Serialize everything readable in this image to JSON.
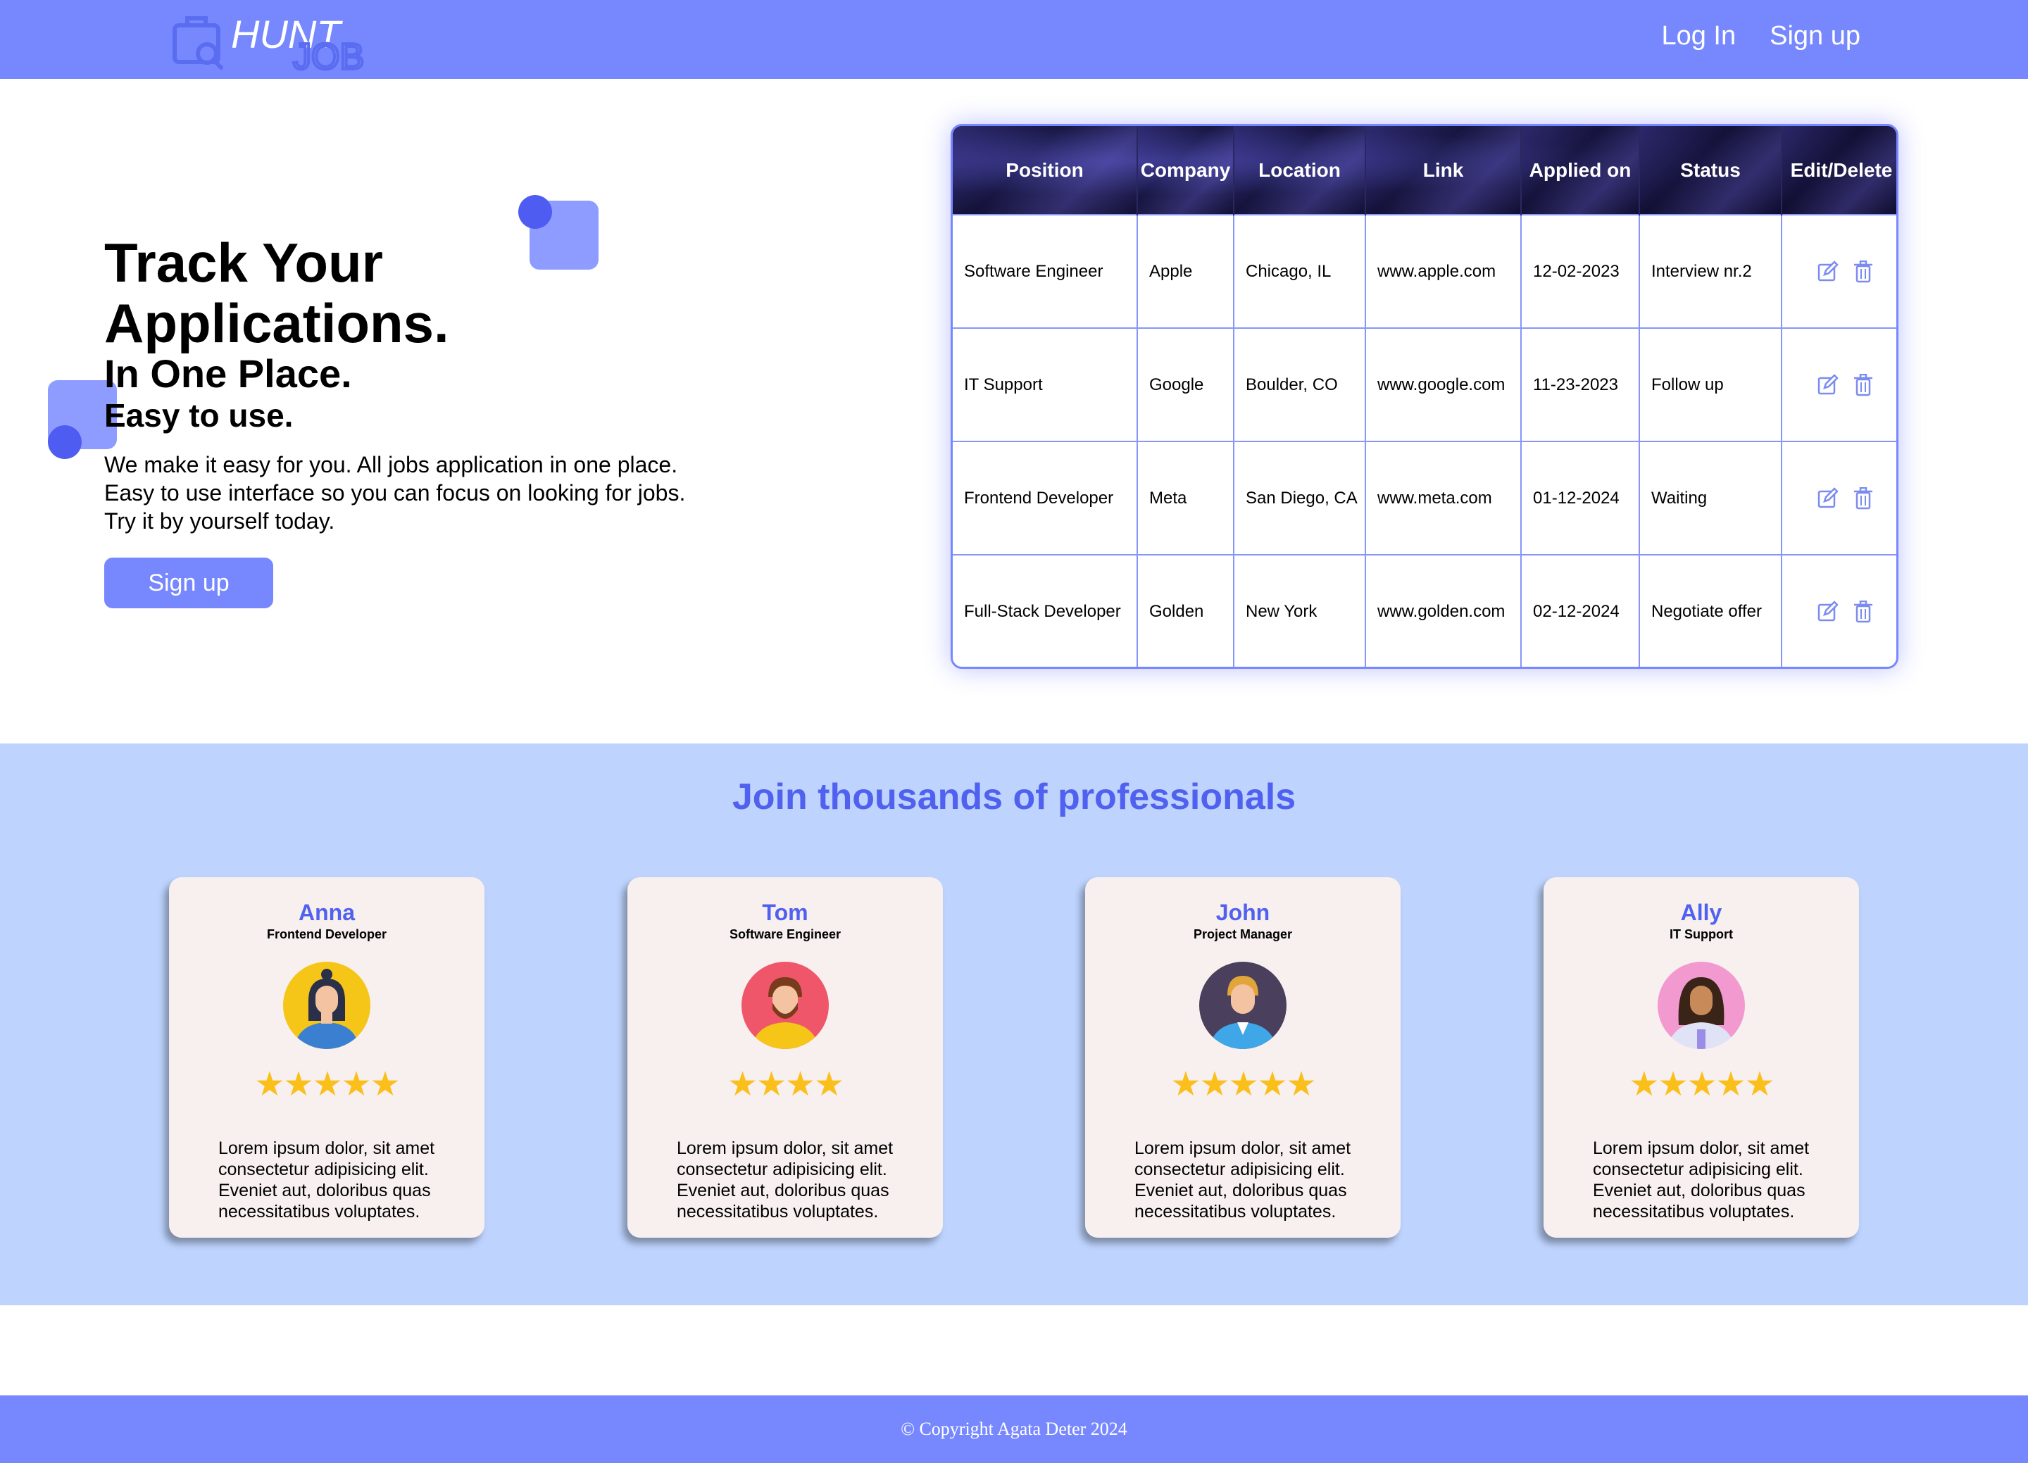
{
  "header": {
    "logo_text_1": "HUNT",
    "logo_text_2": "JOB",
    "login_label": "Log In",
    "signup_label": "Sign up"
  },
  "hero": {
    "title": "Track Your Applications.",
    "subtitle": "In One Place.",
    "tagline": "Easy to use.",
    "line1": "We make it easy for you. All jobs application in one place.",
    "line2": "Easy to use interface so you can focus on looking for jobs.",
    "line3": "Try it by yourself today.",
    "cta_label": "Sign up"
  },
  "table": {
    "columns": [
      "Position",
      "Company",
      "Location",
      "Link",
      "Applied on",
      "Status",
      "Edit/Delete"
    ],
    "rows": [
      [
        "Software Engineer",
        "Apple",
        "Chicago, IL",
        "www.apple.com",
        "12-02-2023",
        "Interview nr.2"
      ],
      [
        "IT Support",
        "Google",
        "Boulder, CO",
        "www.google.com",
        "11-23-2023",
        "Follow up"
      ],
      [
        "Frontend Developer",
        "Meta",
        "San Diego, CA",
        "www.meta.com",
        "01-12-2024",
        "Waiting"
      ],
      [
        "Full-Stack Developer",
        "Golden",
        "New York",
        "www.golden.com",
        "02-12-2024",
        "Negotiate offer"
      ]
    ],
    "icons": {
      "edit": "edit-icon",
      "delete": "trash-icon"
    }
  },
  "testimonials": {
    "title": "Join thousands of professionals",
    "cards": [
      {
        "name": "Anna",
        "role": "Frontend Developer",
        "stars": "★★★★★",
        "text": "Lorem ipsum dolor, sit amet consectetur adipisicing elit. Eveniet aut, doloribus quas necessitatibus voluptates."
      },
      {
        "name": "Tom",
        "role": "Software Engineer",
        "stars": "★★★★",
        "text": "Lorem ipsum dolor, sit amet consectetur adipisicing elit. Eveniet aut, doloribus quas necessitatibus voluptates."
      },
      {
        "name": "John",
        "role": "Project Manager",
        "stars": "★★★★★",
        "text": "Lorem ipsum dolor, sit amet consectetur adipisicing elit. Eveniet aut, doloribus quas necessitatibus voluptates."
      },
      {
        "name": "Ally",
        "role": "IT Support",
        "stars": "★★★★★",
        "text": "Lorem ipsum dolor, sit amet consectetur adipisicing elit. Eveniet aut, doloribus quas necessitatibus voluptates."
      }
    ]
  },
  "footer": {
    "copyright": "© Copyright Agata Deter 2024"
  },
  "colors": {
    "accent": "#7788ff",
    "brand_blue": "#5061ef",
    "band": "#bed4fe",
    "star": "#fbbf1c"
  }
}
